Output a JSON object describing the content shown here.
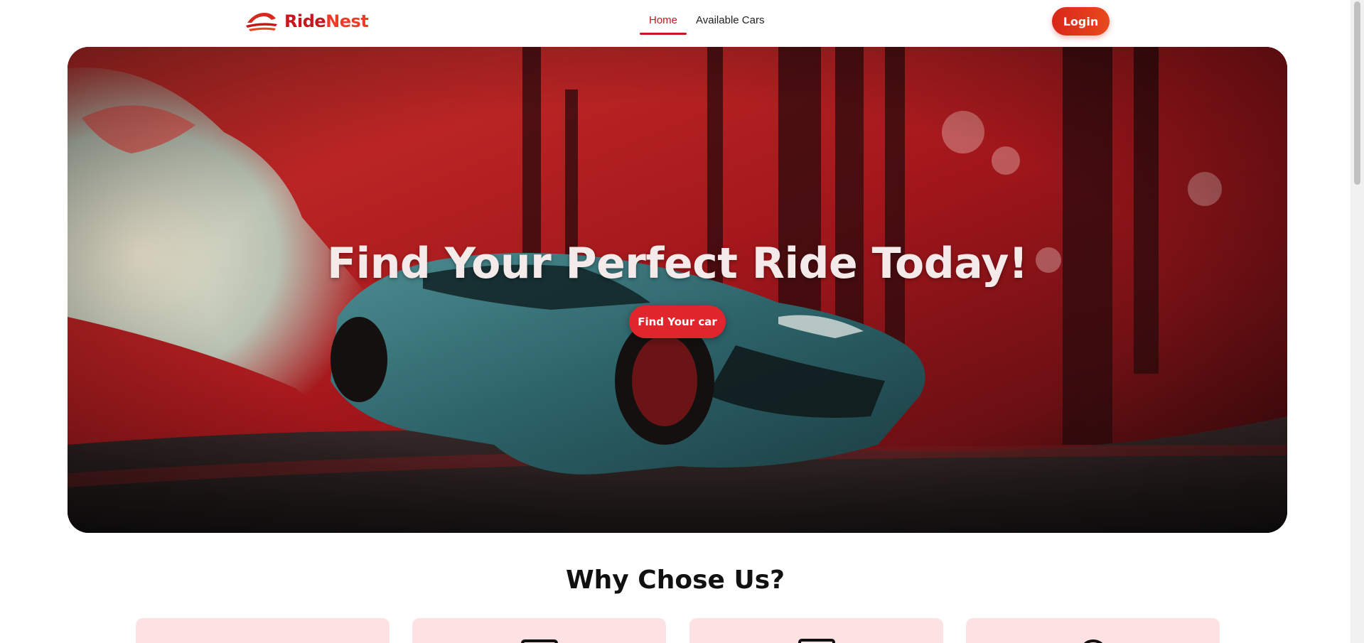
{
  "brand": {
    "name_part1": "Ride",
    "name_part2": "Nest"
  },
  "nav": {
    "items": [
      {
        "label": "Home",
        "active": true
      },
      {
        "label": "Available Cars",
        "active": false
      }
    ],
    "login_label": "Login"
  },
  "hero": {
    "title": "Find Your Perfect Ride Today!",
    "cta_label": "Find Your car"
  },
  "why": {
    "title": "Why Chose Us?",
    "cards": [
      {
        "icon": "blank"
      },
      {
        "icon": "car-icon"
      },
      {
        "icon": "document-icon"
      },
      {
        "icon": "search-icon"
      }
    ]
  },
  "colors": {
    "brand_red": "#c8161d",
    "accent_orange": "#ef3b2a",
    "card_bg": "#fde2e3"
  }
}
